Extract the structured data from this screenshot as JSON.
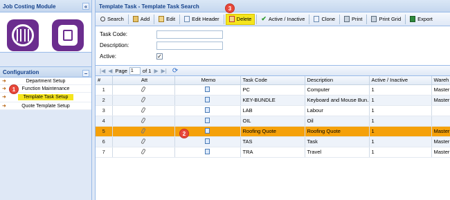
{
  "left": {
    "title": "Job Costing Module",
    "collapse_glyph": "«",
    "config_title": "Configuration",
    "config_toggle": "−",
    "menu": [
      {
        "label": "Department Setup"
      },
      {
        "label": "Function Maintenance"
      },
      {
        "label": "Template Task Setup"
      },
      {
        "label": "Quote Template Setup"
      }
    ]
  },
  "markers": {
    "m1": "1",
    "m2": "2",
    "m3": "3"
  },
  "main": {
    "title": "Template Task - Template Task Search",
    "toolbar": {
      "search": "Search",
      "add": "Add",
      "edit": "Edit",
      "edit_header": "Edit Header",
      "delete": "Delete",
      "active_inactive": "Active / Inactive",
      "clone": "Clone",
      "print": "Print",
      "print_grid": "Print Grid",
      "export": "Export"
    },
    "form": {
      "task_code_label": "Task Code:",
      "task_code_value": "",
      "description_label": "Description:",
      "description_value": "",
      "active_label": "Active:",
      "active_checked": "✓"
    },
    "pager": {
      "page_label": "Page",
      "page_value": "1",
      "of_label": "of 1"
    },
    "grid": {
      "columns": [
        "#",
        "Att",
        "Memo",
        "Task Code",
        "Description",
        "Active / Inactive",
        "Wareh"
      ],
      "rows": [
        {
          "num": "1",
          "code": "PC",
          "desc": "Computer",
          "active": "1",
          "ware": "Master"
        },
        {
          "num": "2",
          "code": "KEY-BUNDLE",
          "desc": "Keyboard and Mouse Bun...",
          "active": "1",
          "ware": "Master"
        },
        {
          "num": "3",
          "code": "LAB",
          "desc": "Labour",
          "active": "1",
          "ware": ""
        },
        {
          "num": "4",
          "code": "OIL",
          "desc": "Oil",
          "active": "1",
          "ware": ""
        },
        {
          "num": "5",
          "code": "Roofing Quote",
          "desc": "Roofing Quote",
          "active": "1",
          "ware": "Master"
        },
        {
          "num": "6",
          "code": "TAS",
          "desc": "Task",
          "active": "1",
          "ware": "Master"
        },
        {
          "num": "7",
          "code": "TRA",
          "desc": "Travel",
          "active": "1",
          "ware": "Master"
        }
      ]
    }
  },
  "colors": {
    "accent": "#15428b",
    "highlight": "#f5e51d",
    "selected_row": "#f5a10a",
    "marker": "#e8483a",
    "app_icon": "#6b2d8e"
  }
}
